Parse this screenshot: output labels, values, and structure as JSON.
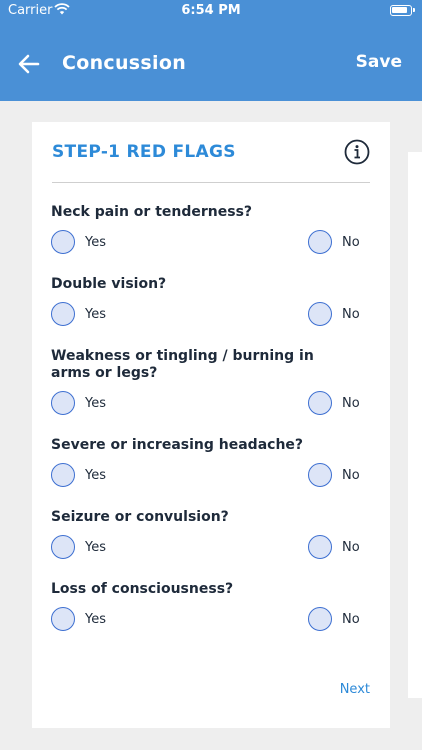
{
  "status_bar": {
    "carrier": "Carrier",
    "time": "6:54 PM"
  },
  "nav": {
    "title": "Concussion",
    "save_label": "Save"
  },
  "card": {
    "title": "STEP-1 RED FLAGS",
    "questions": [
      {
        "text": "Neck pain or tenderness?",
        "yes": "Yes",
        "no": "No"
      },
      {
        "text": "Double vision?",
        "yes": "Yes",
        "no": "No"
      },
      {
        "text": "Weakness or tingling / burning in arms or legs?",
        "yes": "Yes",
        "no": "No"
      },
      {
        "text": "Severe or increasing headache?",
        "yes": "Yes",
        "no": "No"
      },
      {
        "text": "Seizure or convulsion?",
        "yes": "Yes",
        "no": "No"
      },
      {
        "text": "Loss of consciousness?",
        "yes": "Yes",
        "no": "No"
      }
    ],
    "next_label": "Next"
  },
  "colors": {
    "brand": "#4a90d6",
    "accent": "#2d8ad8",
    "radio_border": "#3d6fd1",
    "radio_fill": "#dde5f7"
  },
  "icons": {
    "back": "arrow-left-icon",
    "info": "info-icon",
    "wifi": "wifi-icon",
    "battery": "battery-icon"
  }
}
